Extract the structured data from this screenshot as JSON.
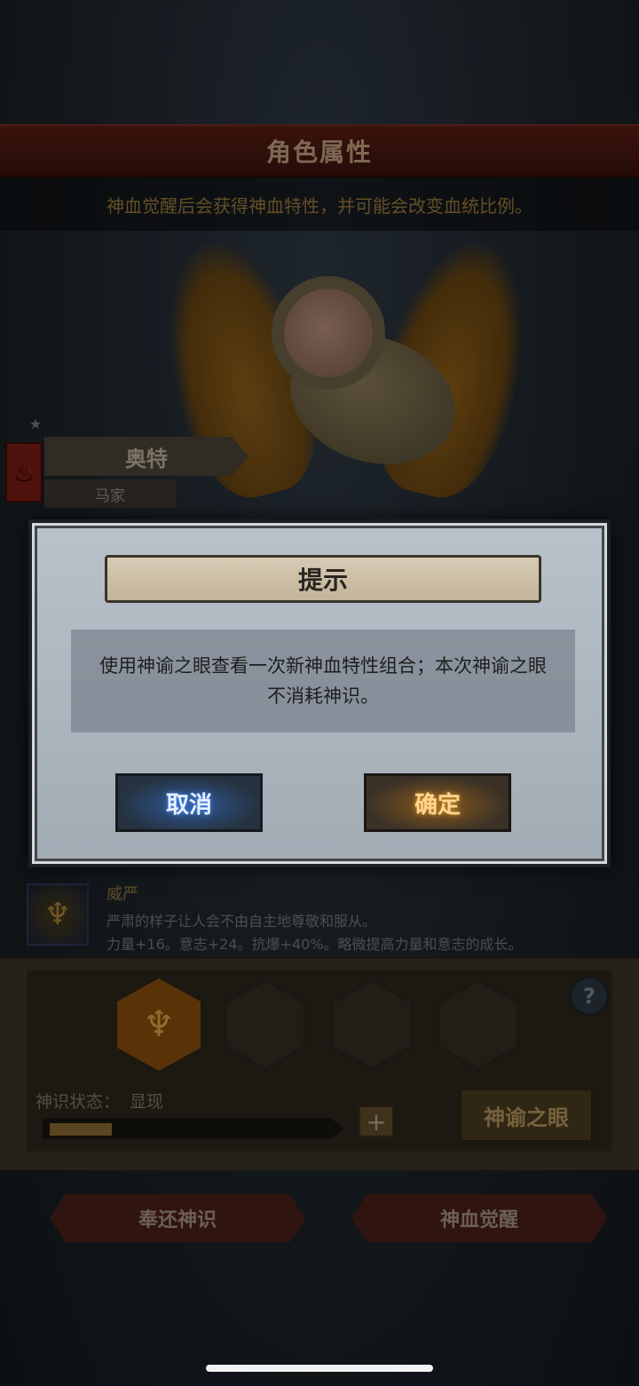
{
  "header": {
    "title": "角色属性",
    "subtitle": "神血觉醒后会获得神血特性，并可能会改变血统比例。"
  },
  "character": {
    "name": "奥特",
    "family": "马家"
  },
  "dialog": {
    "title": "提示",
    "message": "使用神谕之眼查看一次新神血特性组合；本次神谕之眼不消耗神识。",
    "cancel_label": "取消",
    "confirm_label": "确定"
  },
  "trait": {
    "name": "威严",
    "description": "严肃的样子让人会不由自主地尊敬和服从。",
    "stats": "力量+16。意志+24。抗爆+40%。略微提高力量和意志的成长。"
  },
  "divine_sense": {
    "label": "神识状态：",
    "value": "显现",
    "progress": 0.22,
    "plus_label": "+",
    "oracle_label": "神谕之眼"
  },
  "help_label": "?",
  "actions": {
    "return_label": "奉还神识",
    "awaken_label": "神血觉醒"
  },
  "icons": {
    "star": "star-icon",
    "flame": "flame-icon",
    "wings": "golden-wings-icon",
    "trait": "horned-crest-icon"
  },
  "colors": {
    "accent_gold": "#c49a45",
    "title_bar_red": "#5a1e14",
    "cancel_blue": "#2d5a9a",
    "confirm_orange": "#8a5a1e"
  }
}
